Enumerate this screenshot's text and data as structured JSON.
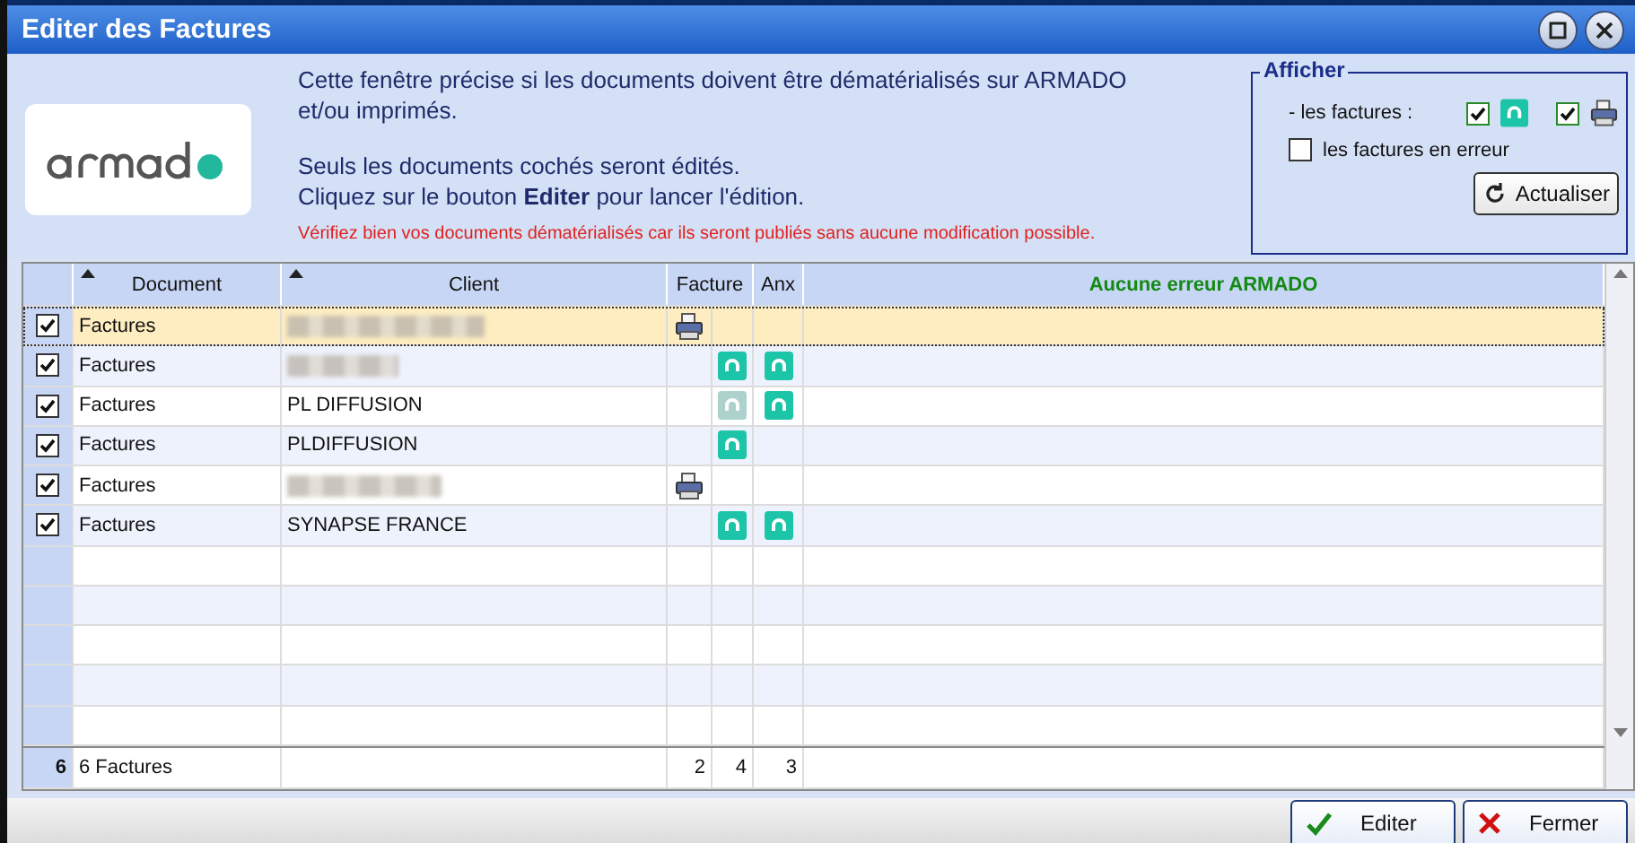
{
  "window": {
    "title": "Editer des Factures"
  },
  "intro": {
    "line_1": "Cette fenêtre précise si les documents doivent être dématérialisés sur ARMADO",
    "line_2": "et/ou imprimés.",
    "line_3": "Seuls les documents cochés seront édités.",
    "line_4": "Cliquez sur le bouton **Editer** pour lancer l'édition.",
    "warning": "Vérifiez bien vos documents dématérialisés car ils seront publiés sans aucune modification possible."
  },
  "afficher": {
    "title": "Afficher",
    "factures_label": "- les factures  :",
    "armado_checked": true,
    "print_checked": true,
    "errors_label": "les factures en erreur",
    "errors_checked": false,
    "refresh_button": "Actualiser"
  },
  "table": {
    "columns": [
      "Document",
      "Client",
      "Facture",
      "Anx",
      "Aucune erreur ARMADO"
    ],
    "rows": [
      {
        "checked": true,
        "selected": true,
        "document": "Factures",
        "redacted": true,
        "print": true,
        "armado": false,
        "armado_dimmed": false,
        "anx": false
      },
      {
        "checked": true,
        "selected": false,
        "document": "Factures",
        "redacted": true,
        "print": false,
        "armado": true,
        "armado_dimmed": false,
        "anx": true
      },
      {
        "checked": true,
        "selected": false,
        "document": "Factures",
        "client": "PL DIFFUSION",
        "redacted": false,
        "print": false,
        "armado": true,
        "armado_dimmed": true,
        "anx": true
      },
      {
        "checked": true,
        "selected": false,
        "document": "Factures",
        "client": "PLDIFFUSION",
        "redacted": false,
        "print": false,
        "armado": true,
        "armado_dimmed": false,
        "anx": false
      },
      {
        "checked": true,
        "selected": false,
        "document": "Factures",
        "redacted": true,
        "print": true,
        "armado": false,
        "armado_dimmed": false,
        "anx": false
      },
      {
        "checked": true,
        "selected": false,
        "document": "Factures",
        "client": "SYNAPSE FRANCE",
        "redacted": false,
        "print": false,
        "armado": true,
        "armado_dimmed": false,
        "anx": true
      }
    ],
    "footer": {
      "count": "6",
      "document": "6 Factures",
      "print_total": "2",
      "armado_total": "4",
      "anx_total": "3"
    }
  },
  "buttons": [
    {
      "kind": "ok",
      "label": "Editer"
    },
    {
      "kind": "cancel",
      "label": "Fermer"
    }
  ]
}
